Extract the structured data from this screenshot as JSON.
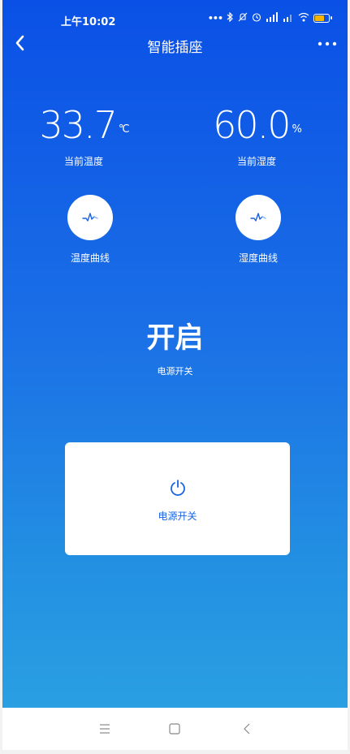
{
  "status_bar": {
    "time": "上午10:02",
    "icons": [
      "more-dots-icon",
      "bluetooth-icon",
      "mute-icon",
      "alarm-icon",
      "hd-signal-icon",
      "signal-icon",
      "wifi-icon",
      "battery-icon"
    ]
  },
  "header": {
    "title": "智能插座",
    "back_icon": "back-arrow-icon",
    "more_icon": "more-icon"
  },
  "readings": {
    "temperature": {
      "value": "33.7",
      "unit": "°C",
      "label": "当前温度"
    },
    "humidity": {
      "value": "60.0",
      "unit": "%",
      "label": "当前湿度"
    }
  },
  "curves": {
    "temperature_label": "温度曲线",
    "humidity_label": "湿度曲线"
  },
  "power": {
    "state": "开启",
    "caption": "电源开关",
    "button_label": "电源开关"
  },
  "nav_bar": {
    "items": [
      "menu-icon",
      "home-icon",
      "back-icon"
    ]
  },
  "colors": {
    "gradient_top": "#0a50e6",
    "gradient_bottom": "#2a9fe2",
    "accent": "#1a63e0",
    "battery": "#f5b400"
  }
}
